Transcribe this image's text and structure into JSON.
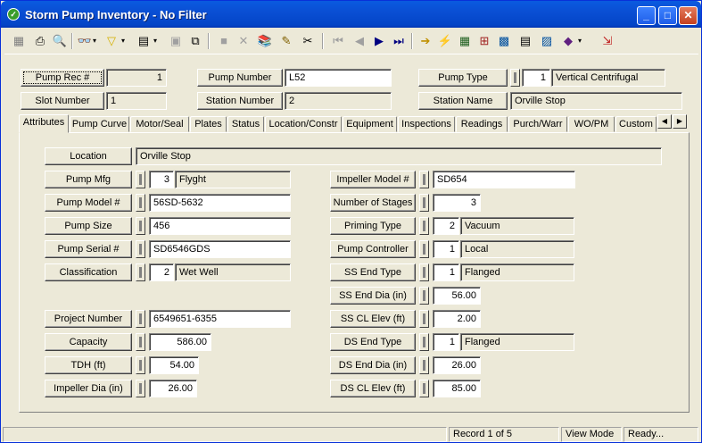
{
  "window": {
    "title": "Storm Pump Inventory - No Filter"
  },
  "header": {
    "pump_rec_label": "Pump Rec #",
    "pump_rec_value": "1",
    "pump_number_label": "Pump Number",
    "pump_number_value": "L52",
    "pump_type_label": "Pump Type",
    "pump_type_code": "1",
    "pump_type_value": "Vertical Centrifugal",
    "slot_number_label": "Slot Number",
    "slot_number_value": "1",
    "station_number_label": "Station Number",
    "station_number_value": "2",
    "station_name_label": "Station Name",
    "station_name_value": "Orville Stop"
  },
  "tabs": [
    "Attributes",
    "Pump Curve",
    "Motor/Seal",
    "Plates",
    "Status",
    "Location/Constr",
    "Equipment",
    "Inspections",
    "Readings",
    "Purch/Warr",
    "WO/PM",
    "Custom"
  ],
  "attributes": {
    "location_label": "Location",
    "location_value": "Orville Stop",
    "pump_mfg_label": "Pump Mfg",
    "pump_mfg_code": "3",
    "pump_mfg_value": "Flyght",
    "pump_model_label": "Pump Model #",
    "pump_model_value": "56SD-5632",
    "pump_size_label": "Pump Size",
    "pump_size_value": "456",
    "pump_serial_label": "Pump Serial #",
    "pump_serial_value": "SD6546GDS",
    "classification_label": "Classification",
    "classification_code": "2",
    "classification_value": "Wet Well",
    "project_number_label": "Project Number",
    "project_number_value": "6549651-6355",
    "capacity_label": "Capacity",
    "capacity_value": "586.00",
    "tdh_label": "TDH (ft)",
    "tdh_value": "54.00",
    "impeller_dia_label": "Impeller Dia (in)",
    "impeller_dia_value": "26.00",
    "impeller_model_label": "Impeller Model #",
    "impeller_model_value": "SD654",
    "stages_label": "Number of Stages",
    "stages_value": "3",
    "priming_type_label": "Priming Type",
    "priming_type_code": "2",
    "priming_type_value": "Vacuum",
    "pump_controller_label": "Pump Controller",
    "pump_controller_code": "1",
    "pump_controller_value": "Local",
    "ss_end_type_label": "SS End Type",
    "ss_end_type_code": "1",
    "ss_end_type_value": "Flanged",
    "ss_end_dia_label": "SS End Dia (in)",
    "ss_end_dia_value": "56.00",
    "ss_cl_elev_label": "SS CL Elev (ft)",
    "ss_cl_elev_value": "2.00",
    "ds_end_type_label": "DS End Type",
    "ds_end_type_code": "1",
    "ds_end_type_value": "Flanged",
    "ds_end_dia_label": "DS End Dia (in)",
    "ds_end_dia_value": "26.00",
    "ds_cl_elev_label": "DS CL Elev (ft)",
    "ds_cl_elev_value": "85.00"
  },
  "status": {
    "record": "Record 1 of 5",
    "mode": "View Mode",
    "state": "Ready..."
  },
  "colors": {
    "titlebar": "#0a4fd4",
    "window_bg": "#ece9d8"
  }
}
